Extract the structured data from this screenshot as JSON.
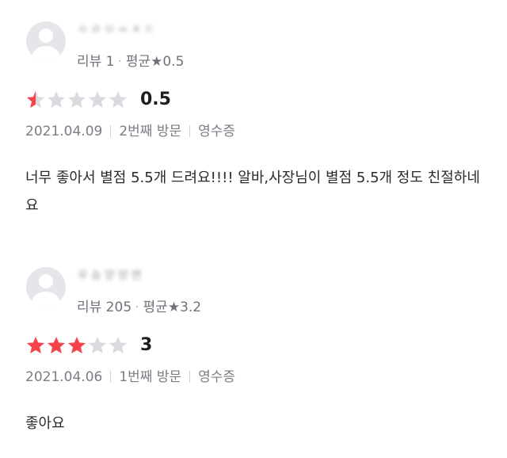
{
  "reviews": [
    {
      "nickname": "ㅇㄹㅁㅆㅊㄷ",
      "review_count_label": "리뷰 1",
      "average_label": "평균★0.5",
      "rating": 0.5,
      "score_text": "0.5",
      "date": "2021.04.09",
      "visit": "2번째 방문",
      "verification": "영수증",
      "content": "너무 좋아서 별점 5.5개 드려요!!!! 알바,사장님이 별점 5.5개 정도 친절하네요"
    },
    {
      "nickname": "우승양양변",
      "review_count_label": "리뷰 205",
      "average_label": "평균★3.2",
      "rating": 3,
      "score_text": "3",
      "date": "2021.04.06",
      "visit": "1번째 방문",
      "verification": "영수증",
      "content": "좋아요"
    }
  ],
  "colors": {
    "star_filled": "#f6424a",
    "star_empty": "#d9dbe0"
  },
  "icons": {
    "avatar": "user-avatar-icon",
    "star": "star-icon"
  }
}
